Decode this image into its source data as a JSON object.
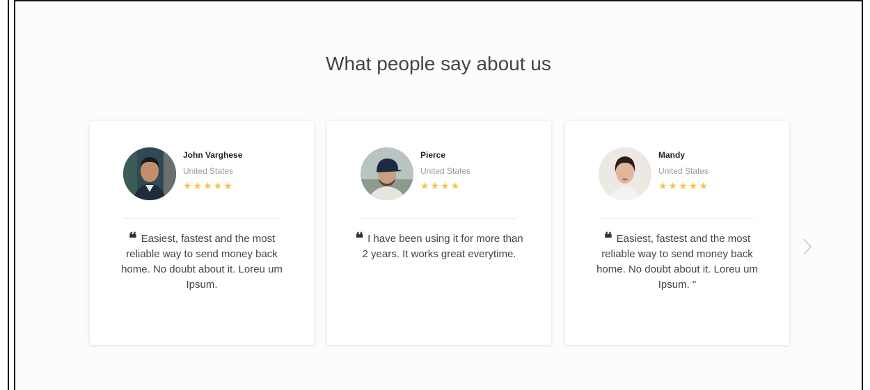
{
  "section": {
    "title": "What people say about us"
  },
  "testimonials": [
    {
      "name": "John Varghese",
      "country": "United States",
      "stars": "★★★★★",
      "rating": 5,
      "quote": "Easiest, fastest and the most reliable way to send money back home. No doubt about it. Loreu um Ipsum."
    },
    {
      "name": "Pierce",
      "country": "United States",
      "stars": "★★★★",
      "rating": 4,
      "quote": "I have been using it for more than 2 years. It works great everytime."
    },
    {
      "name": "Mandy",
      "country": "United States",
      "stars": "★★★★★",
      "rating": 5,
      "quote": "Easiest, fastest and the most reliable way to send money back home. No doubt about it. Loreu um Ipsum. \""
    }
  ],
  "icons": {
    "quote": "quote-icon",
    "star": "star-icon",
    "next": "chevron-right-icon"
  },
  "colors": {
    "star": "#f6c343",
    "title": "#444444",
    "background": "#fcfcfc"
  }
}
